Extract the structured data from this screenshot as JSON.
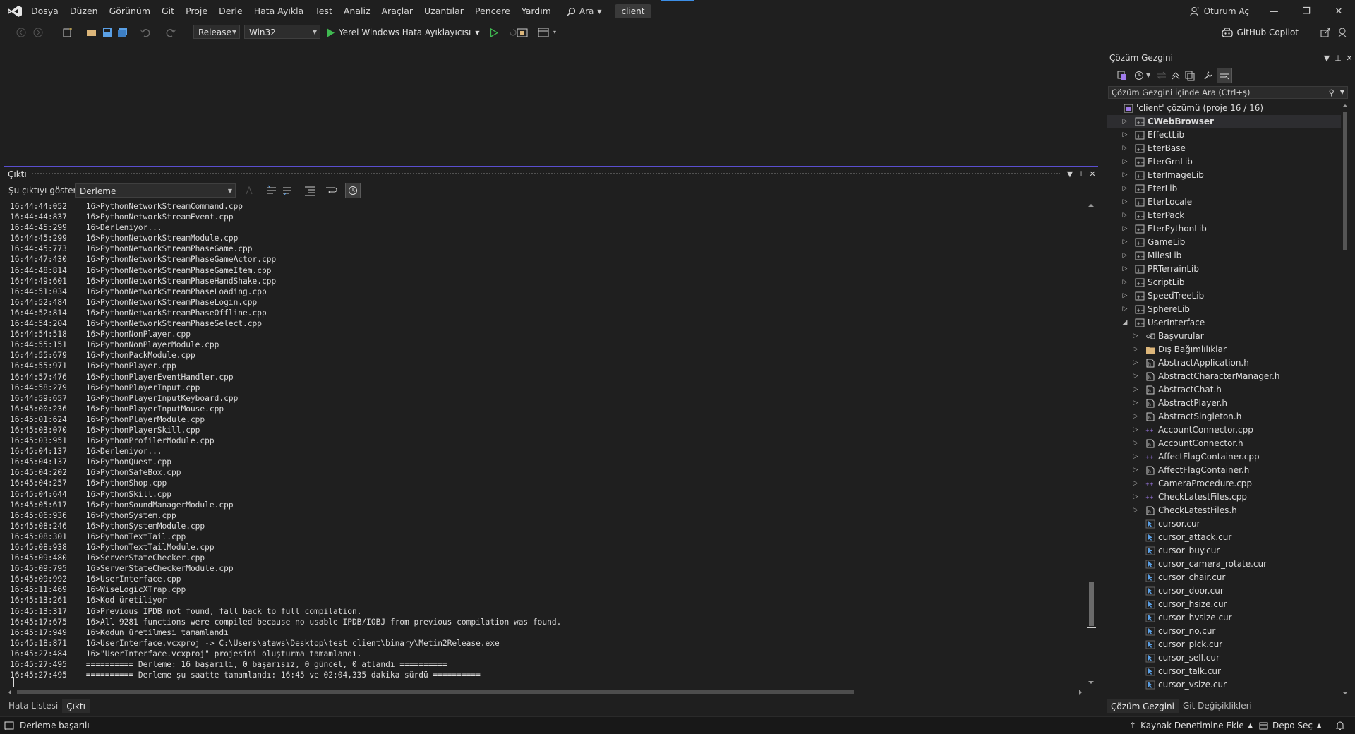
{
  "menubar": {
    "items": [
      "Dosya",
      "Düzen",
      "Görünüm",
      "Git",
      "Proje",
      "Derle",
      "Hata Ayıkla",
      "Test",
      "Analiz",
      "Araçlar",
      "Uzantılar",
      "Pencere",
      "Yardım"
    ],
    "search_label": "Ara",
    "solution_name": "client",
    "signin_label": "Oturum Aç"
  },
  "toolbar": {
    "configuration": "Release",
    "platform": "Win32",
    "run_label": "Yerel Windows Hata Ayıklayıcısı",
    "copilot_label": "GitHub Copilot"
  },
  "output": {
    "title": "Çıktı",
    "show_label": "Şu çıktıyı göster:",
    "source": "Derleme",
    "lines": [
      "16:44:44:052    16>PythonNetworkStreamCommand.cpp",
      "16:44:44:837    16>PythonNetworkStreamEvent.cpp",
      "16:44:45:299    16>Derleniyor...",
      "16:44:45:299    16>PythonNetworkStreamModule.cpp",
      "16:44:45:773    16>PythonNetworkStreamPhaseGame.cpp",
      "16:44:47:430    16>PythonNetworkStreamPhaseGameActor.cpp",
      "16:44:48:814    16>PythonNetworkStreamPhaseGameItem.cpp",
      "16:44:49:601    16>PythonNetworkStreamPhaseHandShake.cpp",
      "16:44:51:034    16>PythonNetworkStreamPhaseLoading.cpp",
      "16:44:52:484    16>PythonNetworkStreamPhaseLogin.cpp",
      "16:44:52:814    16>PythonNetworkStreamPhaseOffline.cpp",
      "16:44:54:204    16>PythonNetworkStreamPhaseSelect.cpp",
      "16:44:54:518    16>PythonNonPlayer.cpp",
      "16:44:55:151    16>PythonNonPlayerModule.cpp",
      "16:44:55:679    16>PythonPackModule.cpp",
      "16:44:55:971    16>PythonPlayer.cpp",
      "16:44:57:476    16>PythonPlayerEventHandler.cpp",
      "16:44:58:279    16>PythonPlayerInput.cpp",
      "16:44:59:657    16>PythonPlayerInputKeyboard.cpp",
      "16:45:00:236    16>PythonPlayerInputMouse.cpp",
      "16:45:01:624    16>PythonPlayerModule.cpp",
      "16:45:03:070    16>PythonPlayerSkill.cpp",
      "16:45:03:951    16>PythonProfilerModule.cpp",
      "16:45:04:137    16>Derleniyor...",
      "16:45:04:137    16>PythonQuest.cpp",
      "16:45:04:202    16>PythonSafeBox.cpp",
      "16:45:04:257    16>PythonShop.cpp",
      "16:45:04:644    16>PythonSkill.cpp",
      "16:45:05:617    16>PythonSoundManagerModule.cpp",
      "16:45:06:936    16>PythonSystem.cpp",
      "16:45:08:246    16>PythonSystemModule.cpp",
      "16:45:08:301    16>PythonTextTail.cpp",
      "16:45:08:938    16>PythonTextTailModule.cpp",
      "16:45:09:480    16>ServerStateChecker.cpp",
      "16:45:09:795    16>ServerStateCheckerModule.cpp",
      "16:45:09:992    16>UserInterface.cpp",
      "16:45:11:469    16>WiseLogicXTrap.cpp",
      "16:45:13:261    16>Kod üretiliyor",
      "16:45:13:317    16>Previous IPDB not found, fall back to full compilation.",
      "16:45:17:675    16>All 9281 functions were compiled because no usable IPDB/IOBJ from previous compilation was found.",
      "16:45:17:949    16>Kodun üretilmesi tamamlandı",
      "16:45:18:871    16>UserInterface.vcxproj -> C:\\Users\\ataws\\Desktop\\test client\\binary\\Metin2Release.exe",
      "16:45:27:484    16>\"UserInterface.vcxproj\" projesini oluşturma tamamlandı.",
      "16:45:27:495    ========== Derleme: 16 başarılı, 0 başarısız, 0 güncel, 0 atlandı ==========",
      "16:45:27:495    ========== Derleme şu saatte tamamlandı: 16:45 ve 02:04,335 dakika sürdü =========="
    ]
  },
  "bottom_tabs": [
    "Hata Listesi",
    "Çıktı"
  ],
  "solution_explorer": {
    "title": "Çözüm Gezgini",
    "search_placeholder": "Çözüm Gezgini İçinde Ara (Ctrl+ş)",
    "tree": [
      {
        "label": "'client' çözümü (proje 16 / 16)",
        "level": 0,
        "icon": "solution-icon",
        "expander": "none",
        "selected": false,
        "bold": false
      },
      {
        "label": "CWebBrowser",
        "level": 1,
        "icon": "project-icon",
        "expander": "collapsed",
        "selected": true,
        "bold": true
      },
      {
        "label": "EffectLib",
        "level": 1,
        "icon": "project-icon",
        "expander": "collapsed"
      },
      {
        "label": "EterBase",
        "level": 1,
        "icon": "project-icon",
        "expander": "collapsed"
      },
      {
        "label": "EterGrnLib",
        "level": 1,
        "icon": "project-icon",
        "expander": "collapsed"
      },
      {
        "label": "EterImageLib",
        "level": 1,
        "icon": "project-icon",
        "expander": "collapsed"
      },
      {
        "label": "EterLib",
        "level": 1,
        "icon": "project-icon",
        "expander": "collapsed"
      },
      {
        "label": "EterLocale",
        "level": 1,
        "icon": "project-icon",
        "expander": "collapsed"
      },
      {
        "label": "EterPack",
        "level": 1,
        "icon": "project-icon",
        "expander": "collapsed"
      },
      {
        "label": "EterPythonLib",
        "level": 1,
        "icon": "project-icon",
        "expander": "collapsed"
      },
      {
        "label": "GameLib",
        "level": 1,
        "icon": "project-icon",
        "expander": "collapsed"
      },
      {
        "label": "MilesLib",
        "level": 1,
        "icon": "project-icon",
        "expander": "collapsed"
      },
      {
        "label": "PRTerrainLib",
        "level": 1,
        "icon": "project-icon",
        "expander": "collapsed"
      },
      {
        "label": "ScriptLib",
        "level": 1,
        "icon": "project-icon",
        "expander": "collapsed"
      },
      {
        "label": "SpeedTreeLib",
        "level": 1,
        "icon": "project-icon",
        "expander": "collapsed"
      },
      {
        "label": "SphereLib",
        "level": 1,
        "icon": "project-icon",
        "expander": "collapsed"
      },
      {
        "label": "UserInterface",
        "level": 1,
        "icon": "project-icon",
        "expander": "expanded"
      },
      {
        "label": "Başvurular",
        "level": 2,
        "icon": "references-icon",
        "expander": "collapsed"
      },
      {
        "label": "Dış Bağımlılıklar",
        "level": 2,
        "icon": "folder-icon",
        "expander": "collapsed"
      },
      {
        "label": "AbstractApplication.h",
        "level": 2,
        "icon": "header-file-icon",
        "expander": "collapsed"
      },
      {
        "label": "AbstractCharacterManager.h",
        "level": 2,
        "icon": "header-file-icon",
        "expander": "collapsed"
      },
      {
        "label": "AbstractChat.h",
        "level": 2,
        "icon": "header-file-icon",
        "expander": "collapsed"
      },
      {
        "label": "AbstractPlayer.h",
        "level": 2,
        "icon": "header-file-icon",
        "expander": "collapsed"
      },
      {
        "label": "AbstractSingleton.h",
        "level": 2,
        "icon": "header-file-icon",
        "expander": "collapsed"
      },
      {
        "label": "AccountConnector.cpp",
        "level": 2,
        "icon": "cpp-file-icon",
        "expander": "collapsed"
      },
      {
        "label": "AccountConnector.h",
        "level": 2,
        "icon": "header-file-icon",
        "expander": "collapsed"
      },
      {
        "label": "AffectFlagContainer.cpp",
        "level": 2,
        "icon": "cpp-file-icon",
        "expander": "collapsed"
      },
      {
        "label": "AffectFlagContainer.h",
        "level": 2,
        "icon": "header-file-icon",
        "expander": "collapsed"
      },
      {
        "label": "CameraProcedure.cpp",
        "level": 2,
        "icon": "cpp-file-icon",
        "expander": "collapsed"
      },
      {
        "label": "CheckLatestFiles.cpp",
        "level": 2,
        "icon": "cpp-file-icon",
        "expander": "collapsed"
      },
      {
        "label": "CheckLatestFiles.h",
        "level": 2,
        "icon": "header-file-icon",
        "expander": "collapsed"
      },
      {
        "label": "cursor.cur",
        "level": 2,
        "icon": "cursor-file-icon",
        "expander": "none"
      },
      {
        "label": "cursor_attack.cur",
        "level": 2,
        "icon": "cursor-file-icon",
        "expander": "none"
      },
      {
        "label": "cursor_buy.cur",
        "level": 2,
        "icon": "cursor-file-icon",
        "expander": "none"
      },
      {
        "label": "cursor_camera_rotate.cur",
        "level": 2,
        "icon": "cursor-file-icon",
        "expander": "none"
      },
      {
        "label": "cursor_chair.cur",
        "level": 2,
        "icon": "cursor-file-icon",
        "expander": "none"
      },
      {
        "label": "cursor_door.cur",
        "level": 2,
        "icon": "cursor-file-icon",
        "expander": "none"
      },
      {
        "label": "cursor_hsize.cur",
        "level": 2,
        "icon": "cursor-file-icon",
        "expander": "none"
      },
      {
        "label": "cursor_hvsize.cur",
        "level": 2,
        "icon": "cursor-file-icon",
        "expander": "none"
      },
      {
        "label": "cursor_no.cur",
        "level": 2,
        "icon": "cursor-file-icon",
        "expander": "none"
      },
      {
        "label": "cursor_pick.cur",
        "level": 2,
        "icon": "cursor-file-icon",
        "expander": "none"
      },
      {
        "label": "cursor_sell.cur",
        "level": 2,
        "icon": "cursor-file-icon",
        "expander": "none"
      },
      {
        "label": "cursor_talk.cur",
        "level": 2,
        "icon": "cursor-file-icon",
        "expander": "none"
      },
      {
        "label": "cursor_vsize.cur",
        "level": 2,
        "icon": "cursor-file-icon",
        "expander": "none"
      }
    ],
    "tabs": [
      "Çözüm Gezgini",
      "Git Değişiklikleri"
    ]
  },
  "statusbar": {
    "message": "Derleme başarılı",
    "source_control": "Kaynak Denetimine Ekle",
    "repo": "Depo Seç"
  },
  "colors": {
    "accent": "#3c8ee6",
    "output_border": "#5a4fcf",
    "run_green": "#3fb950",
    "vs_purple": "#9f7aea"
  }
}
